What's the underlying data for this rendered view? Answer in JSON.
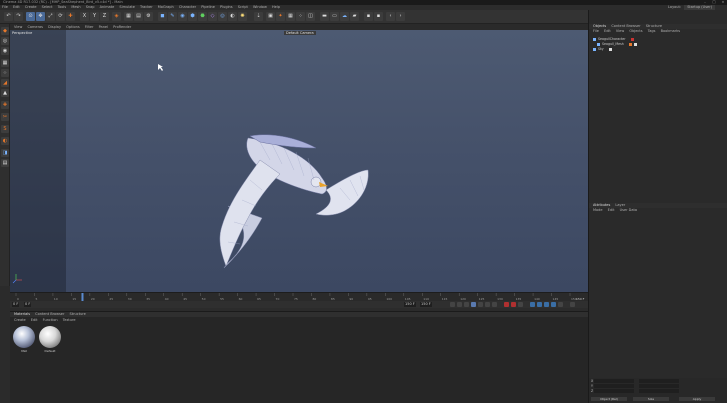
{
  "app": {
    "title": "Cinema 4D R17.032 (RC) - [MHP_SeaShepherd_Bird_v5.c4d *] - Main",
    "window_controls": [
      "minimize-icon",
      "maximize-icon",
      "close-icon"
    ]
  },
  "menu": {
    "items": [
      "File",
      "Edit",
      "Create",
      "Select",
      "Tools",
      "Mesh",
      "Snap",
      "Animate",
      "Simulate",
      "Tracker",
      "MoGraph",
      "Character",
      "Pipeline",
      "Plugins",
      "Script",
      "Window",
      "Help"
    ],
    "layout_label": "Layout:",
    "layout_value": "Startup (User)"
  },
  "viewport": {
    "menu": [
      "View",
      "Cameras",
      "Display",
      "Options",
      "Filter",
      "Panel",
      "ProRender"
    ],
    "label": "Perspective",
    "camera": "Default Camera"
  },
  "timeline": {
    "ticks": [
      "0",
      "5",
      "10",
      "15",
      "20",
      "25",
      "30",
      "35",
      "40",
      "45",
      "50",
      "55",
      "60",
      "65",
      "70",
      "75",
      "80",
      "85",
      "90",
      "95",
      "100",
      "105",
      "110",
      "115",
      "120",
      "125",
      "130",
      "135",
      "140",
      "145",
      "150"
    ],
    "end_frame": "150 F",
    "current_frame": "0 F",
    "start_field": "0 F",
    "total_field": "150 F",
    "max_field": "150 F",
    "playhead_value": 18
  },
  "materials": {
    "tabs": [
      "Materials",
      "Content Browser",
      "Structure"
    ],
    "menu": [
      "Create",
      "Edit",
      "Function",
      "Texture"
    ],
    "items": [
      {
        "label": "Mat"
      },
      {
        "label": "Default"
      }
    ]
  },
  "objects": {
    "tabs": [
      "Objects",
      "Content Browser",
      "Structure"
    ],
    "menu": [
      "File",
      "Edit",
      "View",
      "Objects",
      "Tags",
      "Bookmarks"
    ],
    "rows": [
      {
        "label": "SeagullCharacter"
      },
      {
        "label": "Seagull_Mesh"
      },
      {
        "label": "Sky"
      }
    ]
  },
  "attributes": {
    "tabs": [
      "Attributes",
      "Layer"
    ],
    "menu": [
      "Mode",
      "Edit",
      "User Data"
    ]
  },
  "coordinates": {
    "rows": [
      {
        "axis": "X",
        "pos": "0 cm",
        "size": "0 cm",
        "rot": "H 0°"
      },
      {
        "axis": "Y",
        "pos": "0 cm",
        "size": "0 cm",
        "rot": "P 0°"
      },
      {
        "axis": "Z",
        "pos": "0 cm",
        "size": "0 cm",
        "rot": "B 0°"
      }
    ],
    "mode_left": "Object (Rel)",
    "mode_mid": "Size",
    "apply": "Apply"
  },
  "colors": {
    "accent": "#e8782a",
    "viewport_top": "#4d5a72",
    "selection": "#3a6ea5"
  }
}
